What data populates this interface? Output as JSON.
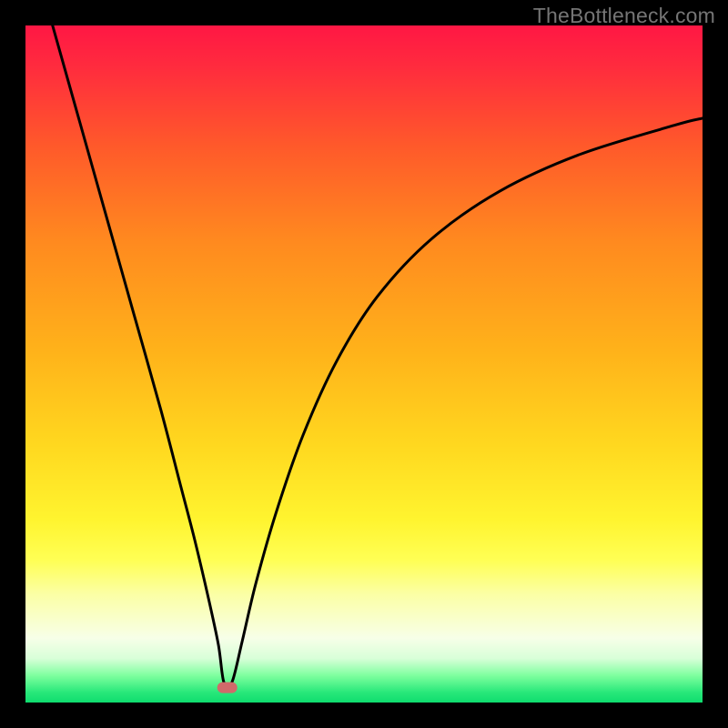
{
  "watermark": "TheBottleneck.com",
  "chart_data": {
    "type": "line",
    "title": "",
    "xlabel": "",
    "ylabel": "",
    "xlim": [
      0,
      100
    ],
    "ylim": [
      0,
      100
    ],
    "series": [
      {
        "name": "curve",
        "x": [
          4,
          8,
          12,
          16,
          20,
          23,
          25,
          27,
          28.5,
          29.3,
          30.5,
          32,
          34,
          37,
          41,
          46,
          52,
          60,
          70,
          82,
          96,
          100
        ],
        "y": [
          100,
          85.8,
          71.6,
          57.4,
          43.2,
          31.7,
          24.0,
          15.5,
          8.5,
          3.0,
          3.0,
          9.0,
          17.5,
          28.0,
          39.5,
          50.5,
          60.0,
          68.5,
          75.5,
          81.0,
          85.3,
          86.3
        ]
      }
    ],
    "marker": {
      "x": 29.8,
      "y": 2.2,
      "color": "#d06a6a"
    },
    "gradient_stops": [
      {
        "offset": 0.0,
        "color": "#ff1744"
      },
      {
        "offset": 0.06,
        "color": "#ff2b3e"
      },
      {
        "offset": 0.18,
        "color": "#ff5a2a"
      },
      {
        "offset": 0.32,
        "color": "#ff8a1f"
      },
      {
        "offset": 0.48,
        "color": "#ffb21a"
      },
      {
        "offset": 0.62,
        "color": "#ffd81f"
      },
      {
        "offset": 0.73,
        "color": "#fff42f"
      },
      {
        "offset": 0.79,
        "color": "#ffff55"
      },
      {
        "offset": 0.84,
        "color": "#fbffa5"
      },
      {
        "offset": 0.905,
        "color": "#f7ffe8"
      },
      {
        "offset": 0.935,
        "color": "#d8ffd8"
      },
      {
        "offset": 0.96,
        "color": "#7fff9f"
      },
      {
        "offset": 0.985,
        "color": "#28e87a"
      },
      {
        "offset": 1.0,
        "color": "#0fdc6e"
      }
    ]
  }
}
